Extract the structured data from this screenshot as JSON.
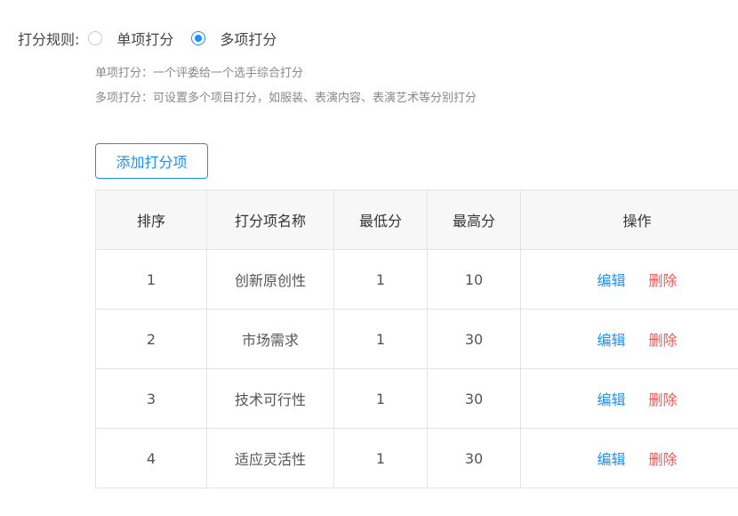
{
  "rule": {
    "label": "打分规则:",
    "options": [
      {
        "label": "单项打分",
        "checked": false
      },
      {
        "label": "多项打分",
        "checked": true
      }
    ],
    "descriptions": [
      "单项打分：一个评委给一个选手综合打分",
      "多项打分：可设置多个项目打分，如服装、表演内容、表演艺术等分别打分"
    ]
  },
  "add_button": "添加打分项",
  "table": {
    "headers": [
      "排序",
      "打分项名称",
      "最低分",
      "最高分",
      "操作"
    ],
    "rows": [
      {
        "order": "1",
        "name": "创新原创性",
        "min": "1",
        "max": "10"
      },
      {
        "order": "2",
        "name": "市场需求",
        "min": "1",
        "max": "30"
      },
      {
        "order": "3",
        "name": "技术可行性",
        "min": "1",
        "max": "30"
      },
      {
        "order": "4",
        "name": "适应灵活性",
        "min": "1",
        "max": "30"
      }
    ],
    "edit_label": "编辑",
    "delete_label": "删除"
  },
  "colors": {
    "primary": "#1890ff",
    "danger": "#f05656"
  }
}
